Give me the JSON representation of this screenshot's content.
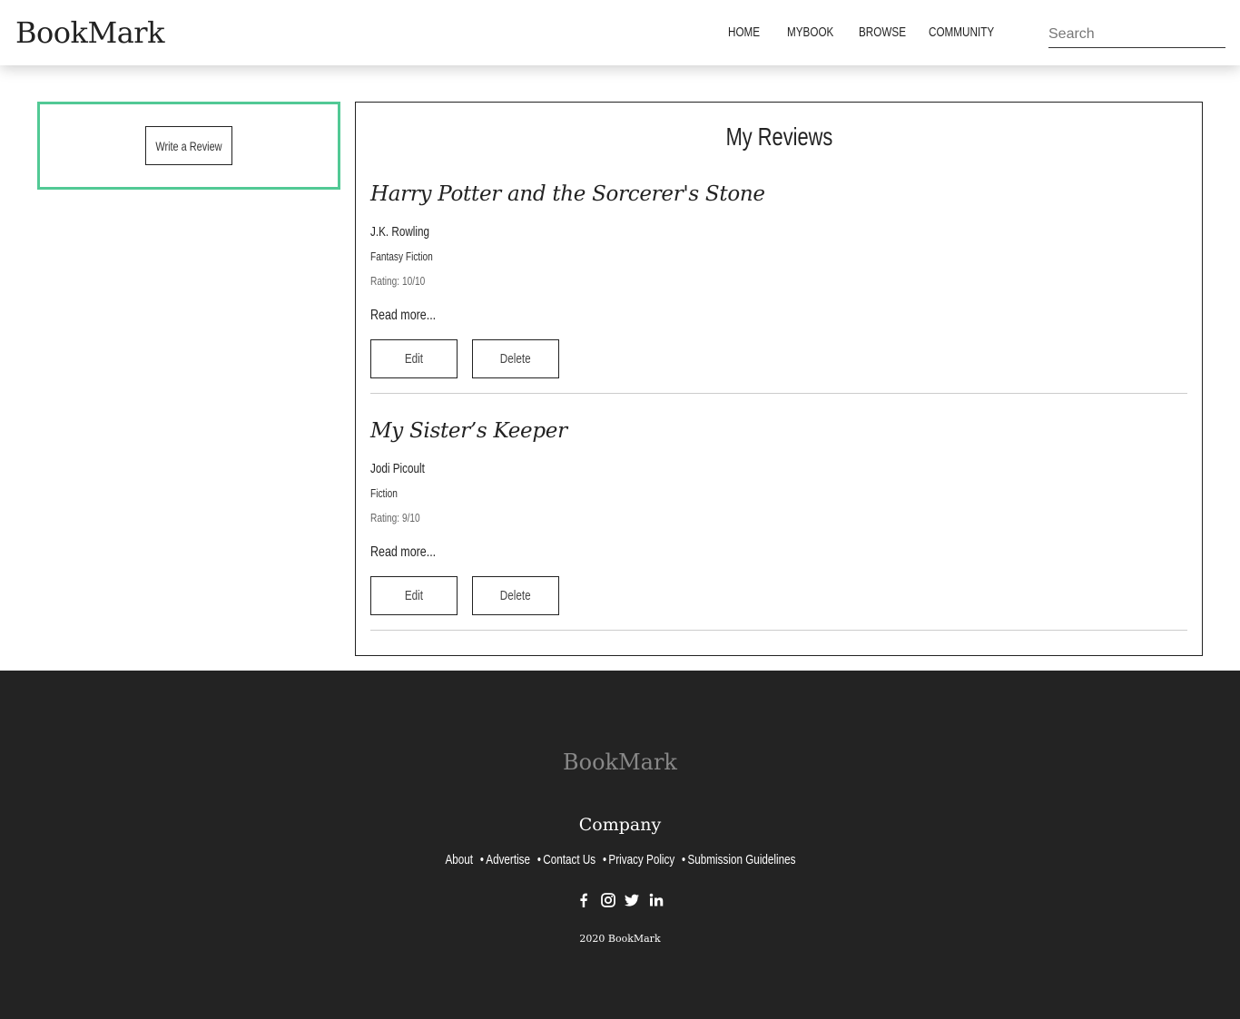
{
  "header": {
    "logo": "BookMark",
    "nav": [
      "HOME",
      "MYBOOK",
      "BROWSE",
      "COMMUNITY"
    ],
    "search_placeholder": "Search"
  },
  "sidebar": {
    "write_review_label": "Write a Review",
    "accent_color": "#52c995"
  },
  "reviews": {
    "title": "My Reviews",
    "items": [
      {
        "book_title": "Harry Potter and the Sorcerer's Stone",
        "author": "J.K. Rowling",
        "genre": "Fantasy Fiction",
        "rating": "Rating: 10/10",
        "read_more": "Read more...",
        "edit_label": "Edit",
        "delete_label": "Delete"
      },
      {
        "book_title": "My Sister’s Keeper",
        "author": "Jodi Picoult",
        "genre": "Fiction",
        "rating": "Rating: 9/10",
        "read_more": "Read more...",
        "edit_label": "Edit",
        "delete_label": "Delete"
      }
    ]
  },
  "footer": {
    "logo": "BookMark",
    "company_heading": "Company",
    "links": [
      "About",
      "Advertise",
      "Contact Us",
      "Privacy Policy",
      "Submission Guidelines"
    ],
    "social_icons": [
      "facebook-icon",
      "instagram-icon",
      "twitter-icon",
      "linkedin-icon"
    ],
    "copyright": "2020 BookMark",
    "background_color": "#232323"
  }
}
